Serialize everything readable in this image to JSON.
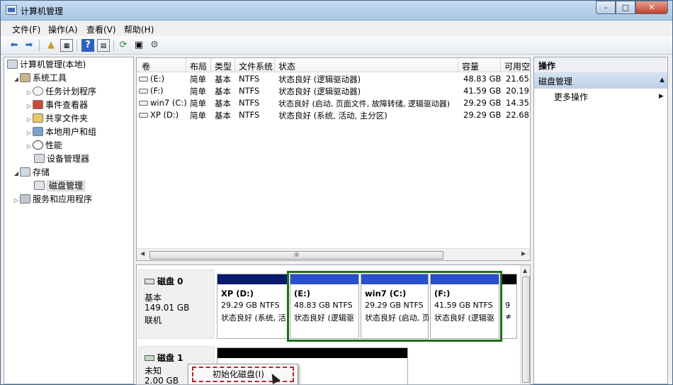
{
  "window": {
    "title": "计算机管理",
    "min_label": "–",
    "max_label": "□",
    "close_label": "✕"
  },
  "menu": [
    "文件(F)",
    "操作(A)",
    "查看(V)",
    "帮助(H)"
  ],
  "toolbar": {
    "icons": [
      "back-icon",
      "forward-icon",
      "up-folder-icon",
      "show-tree-icon",
      "help-icon",
      "properties-icon",
      "refresh-icon",
      "export-icon",
      "settings-icon"
    ]
  },
  "tree": {
    "root": "计算机管理(本地)",
    "system_tools": "系统工具",
    "task_scheduler": "任务计划程序",
    "event_viewer": "事件查看器",
    "shared_folders": "共享文件夹",
    "local_users": "本地用户和组",
    "performance": "性能",
    "device_manager": "设备管理器",
    "storage": "存储",
    "disk_management": "磁盘管理",
    "services": "服务和应用程序"
  },
  "volumes": {
    "headers": [
      "卷",
      "布局",
      "类型",
      "文件系统",
      "状态",
      "容量",
      "可用空"
    ],
    "rows": [
      {
        "name": "(E:)",
        "layout": "简单",
        "type": "基本",
        "fs": "NTFS",
        "status": "状态良好 (逻辑驱动器)",
        "capacity": "48.83 GB",
        "free": "21.65"
      },
      {
        "name": "(F:)",
        "layout": "简单",
        "type": "基本",
        "fs": "NTFS",
        "status": "状态良好 (逻辑驱动器)",
        "capacity": "41.59 GB",
        "free": "20.19"
      },
      {
        "name": "win7 (C:)",
        "layout": "简单",
        "type": "基本",
        "fs": "NTFS",
        "status": "状态良好 (启动, 页面文件, 故障转储, 逻辑驱动器)",
        "capacity": "29.29 GB",
        "free": "14.35"
      },
      {
        "name": "XP (D:)",
        "layout": "简单",
        "type": "基本",
        "fs": "NTFS",
        "status": "状态良好 (系统, 活动, 主分区)",
        "capacity": "29.29 GB",
        "free": "22.68"
      }
    ],
    "scroll_grip": "III"
  },
  "disk0": {
    "title": "磁盘 0",
    "type": "基本",
    "size": "149.01 GB",
    "state": "联机"
  },
  "partitions": [
    {
      "title": "XP  (D:)",
      "size": "29.29 GB NTFS",
      "status": "状态良好 (系统, 活"
    },
    {
      "title": "(E:)",
      "size": "48.83 GB NTFS",
      "status": "状态良好 (逻辑驱"
    },
    {
      "title": "win7  (C:)",
      "size": "29.29 GB NTFS",
      "status": "状态良好 (启动, 页"
    },
    {
      "title": "(F:)",
      "size": "41.59 GB NTFS",
      "status": "状态良好 (逻辑驱"
    },
    {
      "title": "9",
      "size": "",
      "status": "≉"
    }
  ],
  "disk1": {
    "title": "磁盘 1",
    "type": "未知",
    "size": "2.00 GB"
  },
  "context_menu": {
    "item": "初始化磁盘(I)"
  },
  "actions": {
    "header": "操作",
    "section": "磁盘管理",
    "more": "更多操作"
  }
}
